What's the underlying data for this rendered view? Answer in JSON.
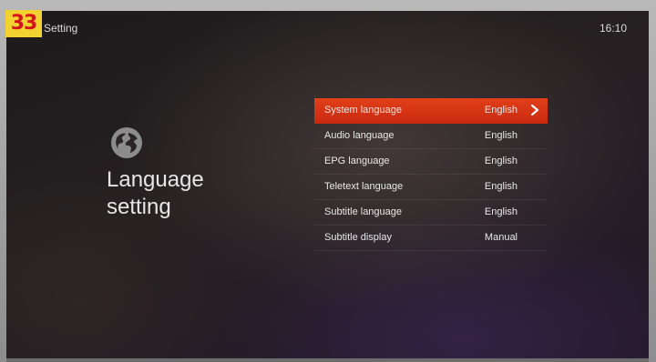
{
  "badge": "33",
  "header": {
    "title": "Setting",
    "time": "16:10"
  },
  "section": {
    "icon": "globe-icon",
    "line1": "Language",
    "line2": "setting"
  },
  "menu": {
    "selected_index": 0,
    "selected_color": "#d9361a",
    "items": [
      {
        "label": "System language",
        "value": "English"
      },
      {
        "label": "Audio language",
        "value": "English"
      },
      {
        "label": "EPG language",
        "value": "English"
      },
      {
        "label": "Teletext language",
        "value": "English"
      },
      {
        "label": "Subtitle language",
        "value": "English"
      },
      {
        "label": "Subtitle display",
        "value": "Manual"
      }
    ]
  }
}
